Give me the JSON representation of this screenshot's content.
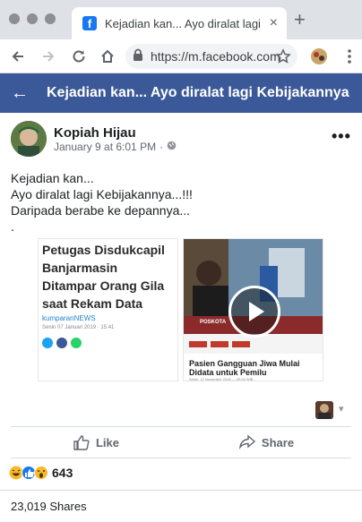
{
  "browser": {
    "tab_title": "Kejadian kan... Ayo diralat lagi Kebijakannya",
    "tab_close": "×",
    "new_tab": "+",
    "url": "https://m.facebook.com"
  },
  "fb": {
    "back_arrow": "←",
    "page_title": "Kejadian kan... Ayo diralat lagi Kebijakannya"
  },
  "post": {
    "author": "Kopiah Hijau",
    "date": "January 9 at 6:01 PM",
    "dot": "·",
    "more": "•••",
    "text": [
      "Kejadian kan...",
      "Ayo diralat lagi Kebijakannya...!!!",
      "Daripada berabe ke depannya...",
      "."
    ]
  },
  "card1": {
    "title": "Petugas Disdukcapil Banjarmasin Ditampar Orang Gila saat Rekam Data",
    "source": "kumparanNEWS",
    "date": "Senin 07 Januari 2019 · 15:41"
  },
  "card2": {
    "brand": "POSKOTA",
    "title": "Pasien Gangguan Jiwa Mulai Didata untuk Pemilu",
    "date": "Senin, 12 November 2018 — 20:06 WIB"
  },
  "actions": {
    "like": "Like",
    "share": "Share",
    "share_chevron": "▾"
  },
  "reactions": {
    "count": "643",
    "icons": [
      "haha-icon",
      "like-icon",
      "wow-icon"
    ]
  },
  "shares": "23,019 Shares",
  "colors": {
    "fb_blue": "#3b5998",
    "chrome_bar": "#dee1e6",
    "like_blue": "#1877f2"
  }
}
